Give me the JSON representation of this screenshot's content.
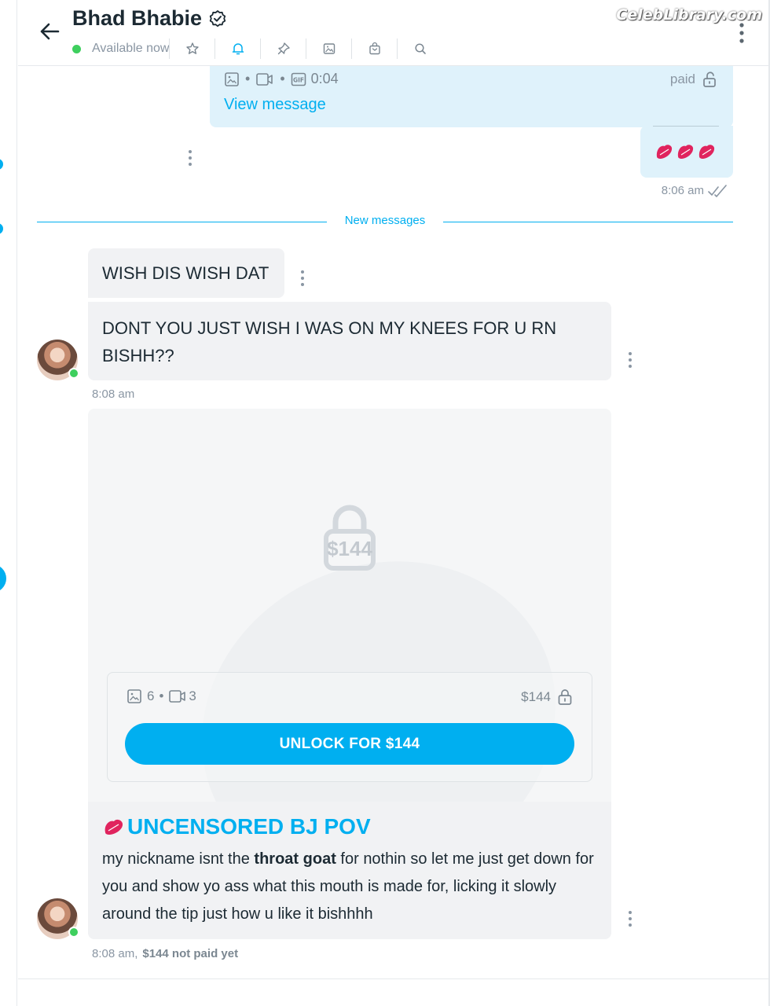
{
  "header": {
    "title": "Bhad Bhabie",
    "status": "Available now",
    "watermark": "CelebLibrary.com",
    "icons": [
      "star-icon",
      "bell-icon",
      "pin-icon",
      "image-icon",
      "bag-icon",
      "search-icon"
    ]
  },
  "sent_message": {
    "duration": "0:04",
    "paid_label": "paid",
    "view_label": "View message",
    "emoji": "💋💋💋",
    "time": "8:06 am"
  },
  "divider": {
    "label": "New messages"
  },
  "messages": [
    {
      "text": "WISH DIS WISH DAT"
    },
    {
      "text": "DONT YOU JUST WISH I WAS ON MY KNEES FOR U RN BISHH??"
    }
  ],
  "first_time": "8:08 am",
  "ppv": {
    "lock_price": "$144",
    "photos": "6",
    "videos": "3",
    "price": "$144",
    "button_label": "UNLOCK FOR $144",
    "title_emoji": "💋",
    "title": "UNCENSORED BJ POV",
    "body_before": "my nickname isnt the ",
    "body_bold": "throat goat",
    "body_after": " for nothin so let me just get down for you and show yo ass what this mouth is made for, licking it slowly around the tip just how u like it bishhhh",
    "time": "8:08 am,",
    "pay_status": "$144 not paid yet"
  },
  "colors": {
    "accent": "#00aff0",
    "online": "#3ecf5e",
    "sent_bg": "#dff2fb",
    "recv_bg": "#f1f2f4"
  }
}
